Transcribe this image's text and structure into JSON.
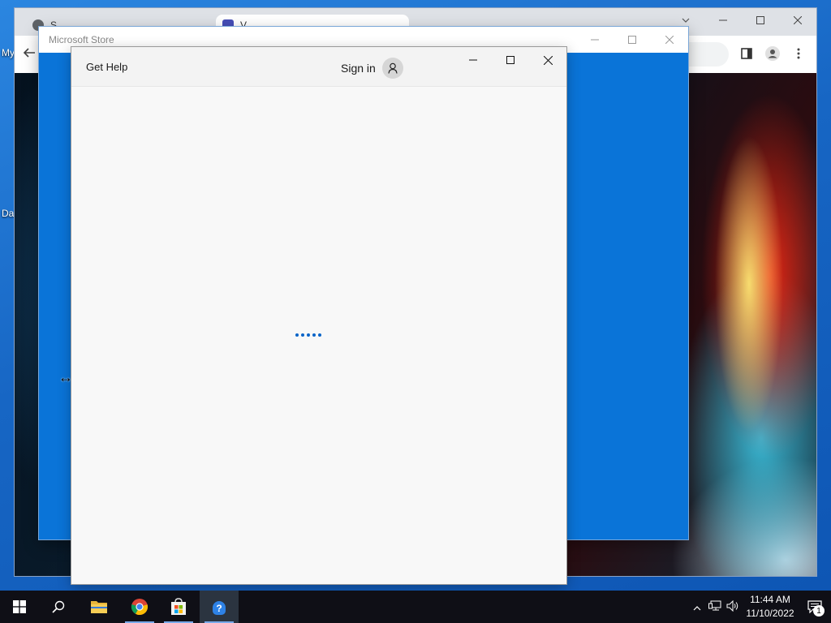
{
  "desktop": {
    "icon_label_1": "My",
    "icon_label_2": "Da"
  },
  "browser": {
    "tabs": [
      {
        "label": "S"
      },
      {
        "label": "V"
      }
    ],
    "icons": {
      "back": "arrow-left-icon",
      "sidebar": "side-panel-icon",
      "profile": "profile-icon",
      "menu": "kebab-menu-icon",
      "info": "info-icon"
    }
  },
  "store_outer": {
    "title": "Microsoft Store"
  },
  "store_inner": {
    "get_help": "Get Help",
    "sign_in": "Sign in",
    "loading_dots": 5
  },
  "taskbar": {
    "apps": [
      {
        "name": "start",
        "icon": "windows-logo-icon"
      },
      {
        "name": "search",
        "icon": "search-icon"
      },
      {
        "name": "file-explorer",
        "icon": "folder-icon"
      },
      {
        "name": "chrome",
        "icon": "chrome-icon"
      },
      {
        "name": "microsoft-store",
        "icon": "store-icon"
      },
      {
        "name": "get-help",
        "icon": "help-icon"
      }
    ],
    "time": "11:44 AM",
    "date": "11/10/2022",
    "notification_count": "1"
  },
  "colors": {
    "accent": "#0a74d8",
    "taskbar": "#0f0f16",
    "store_background": "#f8f8f8"
  }
}
